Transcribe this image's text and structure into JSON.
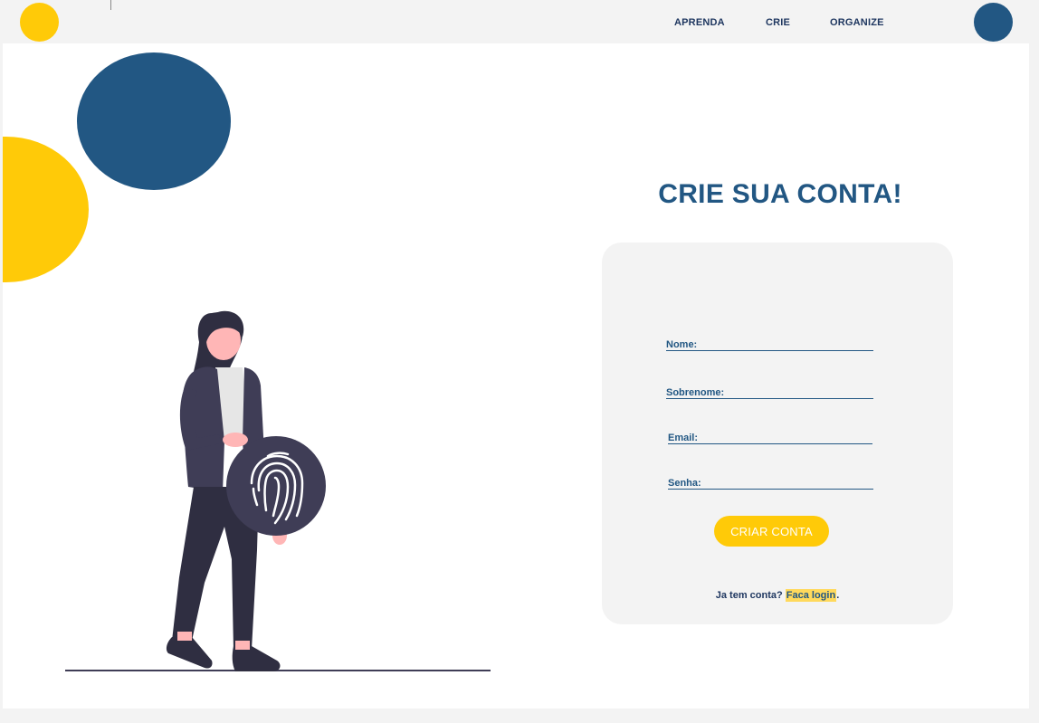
{
  "nav": {
    "items": [
      {
        "label": "APRENDA"
      },
      {
        "label": "CRIE"
      },
      {
        "label": "ORGANIZE"
      }
    ]
  },
  "form": {
    "title": "CRIE SUA CONTA!",
    "fields": [
      {
        "label": "Nome:",
        "value": ""
      },
      {
        "label": "Sobrenome:",
        "value": ""
      },
      {
        "label": "Email:",
        "value": ""
      },
      {
        "label": "Senha:",
        "value": ""
      }
    ],
    "submit_label": "CRIAR CONTA",
    "login_prompt": "Ja tem conta?",
    "login_link": "Faca login",
    "login_suffix": "."
  },
  "colors": {
    "primary": "#225783",
    "accent": "#ffca08",
    "background": "#f3f3f3",
    "illustration_dark": "#2f2e41",
    "illustration_badge": "#3f3d56",
    "illustration_skin": "#ffb6b6"
  },
  "icons": {
    "illustration": "woman-holding-fingerprint-illustration",
    "badge": "fingerprint-icon"
  }
}
